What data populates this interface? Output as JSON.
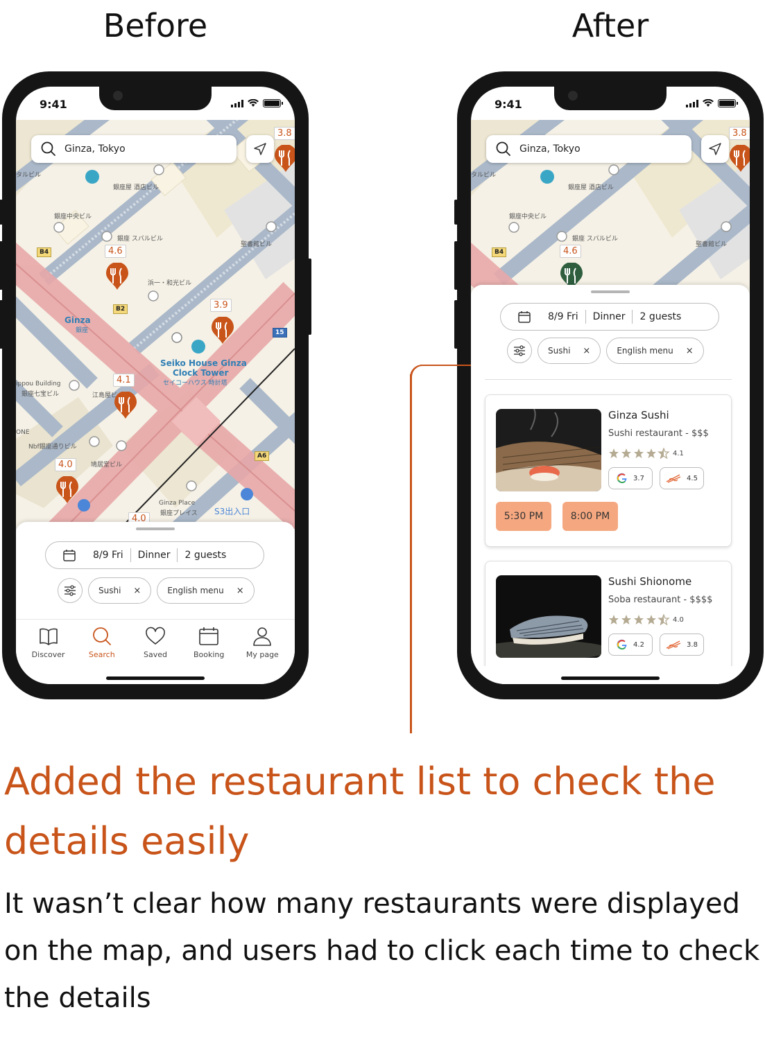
{
  "headings": {
    "before": "Before",
    "after": "After"
  },
  "status": {
    "time": "9:41"
  },
  "search": {
    "query": "Ginza, Tokyo"
  },
  "map": {
    "ratings": {
      "left_edge": "3.8",
      "r1": "4.6",
      "r2": "3.9",
      "r3": "4.1",
      "r4": "4.0",
      "r5": "4.0"
    },
    "labels": {
      "bldg1": "タルビル",
      "bldg2": "銀座屋 酒店ビル",
      "bldg3": "銀座中央ビル",
      "bldg4": "銀座 スバルビル",
      "bldg5": "聖書館ビル",
      "bldg6": "浜一・和光ビル",
      "ginza": "Ginza",
      "ginza_jp": "銀座",
      "seiko1": "Seiko House Ginza",
      "seiko2": "Clock Tower",
      "seiko3": "セイコーハウス 時計塔",
      "nippou1": "ippou Building",
      "nippou2": "銀座七宝ビル",
      "edojima": "江島屋ビ",
      "one": "ONE",
      "nbf": "Nbf銀座通りビル",
      "kyukyodo": "鳩居堂ビル",
      "ginzaplace1": "Ginza Place",
      "ginzaplace2": "銀座プレイス",
      "s3": "S3出入口",
      "b4": "B4",
      "b2": "B2",
      "a6": "A6",
      "n15": "15"
    }
  },
  "filters": {
    "date": "8/9 Fri",
    "meal": "Dinner",
    "guests": "2 guests"
  },
  "chips": [
    {
      "label": "Sushi"
    },
    {
      "label": "English menu"
    }
  ],
  "chip_close": "×",
  "tabs": [
    {
      "label": "Discover",
      "icon": "book-icon"
    },
    {
      "label": "Search",
      "icon": "search-icon"
    },
    {
      "label": "Saved",
      "icon": "heart-icon"
    },
    {
      "label": "Booking",
      "icon": "calendar-icon"
    },
    {
      "label": "My page",
      "icon": "user-icon"
    }
  ],
  "restaurants": [
    {
      "name": "Ginza Sushi",
      "type": "Sushi restaurant - $$$",
      "rating": "4.1",
      "google": "3.7",
      "tabelog": "4.5",
      "slots": [
        "5:30 PM",
        "8:00 PM"
      ]
    },
    {
      "name": "Sushi Shionome",
      "type": "Soba restaurant - $$$$",
      "rating": "4.0",
      "google": "4.2",
      "tabelog": "3.8"
    }
  ],
  "colors": {
    "accent": "#c8541a",
    "slot": "#f5a880",
    "pin_green": "#2e5e3e",
    "map_bg": "#f5f1e6",
    "road": "#aab8c9",
    "road_red": "#e8a8a8"
  },
  "caption": {
    "title": "Added the restaurant list to check the details easily",
    "body": "It wasn’t clear how many restaurants were displayed on the map, and users had to click each time to check the details"
  }
}
